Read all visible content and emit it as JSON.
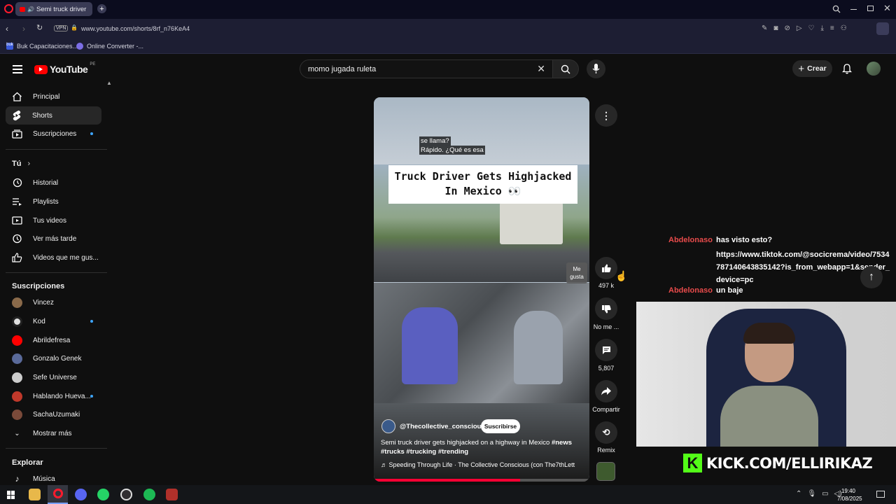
{
  "browser": {
    "tab_title": "Semi truck driver gets",
    "url": "www.youtube.com/shorts/8rf_n76KeA4",
    "vpn_label": "VPN",
    "bookmarks": [
      {
        "label": "Buk Capacitaciones..."
      },
      {
        "label": "Online Converter -..."
      }
    ]
  },
  "youtube": {
    "logo_text": "YouTube",
    "region": "PE",
    "search_value": "momo jugada  ruleta",
    "create_label": "Crear",
    "sidebar": {
      "main": [
        {
          "label": "Principal",
          "icon": "home-icon"
        },
        {
          "label": "Shorts",
          "icon": "shorts-icon",
          "active": true
        },
        {
          "label": "Suscripciones",
          "icon": "subscriptions-icon",
          "dot": true
        }
      ],
      "you_header": "Tú",
      "you": [
        {
          "label": "Historial",
          "icon": "history-icon"
        },
        {
          "label": "Playlists",
          "icon": "playlists-icon"
        },
        {
          "label": "Tus videos",
          "icon": "your-videos-icon"
        },
        {
          "label": "Ver más tarde",
          "icon": "watch-later-icon"
        },
        {
          "label": "Videos que me gus...",
          "icon": "liked-icon"
        }
      ],
      "subs_header": "Suscripciones",
      "subs": [
        {
          "label": "Vincez",
          "color": "#8a6a4a"
        },
        {
          "label": "Kod",
          "color": "#e0e0e0",
          "dot": true
        },
        {
          "label": "Abrildefresa",
          "color": "#ff0000"
        },
        {
          "label": "Gonzalo Genek",
          "color": "#5a6a9a"
        },
        {
          "label": "Sefe Universe",
          "color": "#cccccc"
        },
        {
          "label": "Hablando Hueva...",
          "color": "#c0392b",
          "dot": true
        },
        {
          "label": "SachaUzumaki",
          "color": "#7a4a3a"
        }
      ],
      "more_label": "Mostrar más",
      "explore_header": "Explorar",
      "explore": [
        {
          "label": "Música",
          "icon": "music-icon"
        }
      ]
    },
    "short": {
      "caption_line1": "se llama?",
      "caption_line2": "Rápido. ¿Qué es esa",
      "title_banner": "Truck Driver Gets Highjacked In Mexico 👀",
      "channel": "@Thecollective_conscious",
      "subscribe_label": "Suscribirse",
      "description": "Semi truck driver gets highjacked on a highway in Mexico",
      "hashtags": "#news #trucks #trucking #trending",
      "music": "Speeding Through Life · The Collective Conscious (con The7thLett",
      "like_count": "497 k",
      "like_tooltip": "Me gusta",
      "dislike_label": "No me ...",
      "comment_count": "5,807",
      "share_label": "Compartir",
      "remix_label": "Remix",
      "progress": 0.68
    }
  },
  "chat": [
    {
      "user": "Abdelonaso",
      "message": "has visto esto?"
    },
    {
      "user": "",
      "message": "https://www.tiktok.com/@socicrema/video/7534787140643835142?is_from_webapp=1&sender_device=pc"
    },
    {
      "user": "Abdelonaso",
      "message": "un baje"
    }
  ],
  "stream": {
    "kick_label": "KICK.COM/ELLIRIKAZ"
  },
  "taskbar": {
    "time": "19:40",
    "date": "7/08/2025"
  }
}
